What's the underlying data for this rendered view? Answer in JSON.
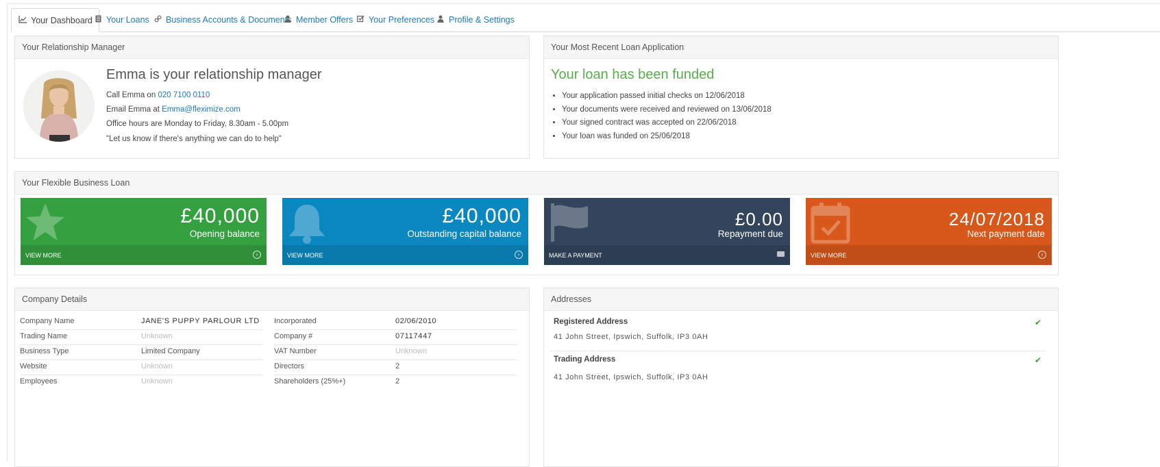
{
  "tabs": [
    {
      "label": "Your Dashboard",
      "icon": "line-chart-icon"
    },
    {
      "label": "Your Loans",
      "icon": "document-icon"
    },
    {
      "label": "Business Accounts & Documents",
      "icon": "link-icon"
    },
    {
      "label": "Member Offers",
      "icon": "user-icon"
    },
    {
      "label": "Your Preferences",
      "icon": "checkbox-icon"
    },
    {
      "label": "Profile & Settings",
      "icon": "user-icon"
    }
  ],
  "relationship_manager": {
    "heading": "Your Relationship Manager",
    "title": "Emma is your relationship manager",
    "call_prefix": "Call Emma on ",
    "phone": "020 7100 0110",
    "email_prefix": "Email Emma at ",
    "email": "Emma@fleximize.com",
    "hours": "Office hours are Monday to Friday, 8.30am - 5.00pm",
    "quote": "\"Let us know if there's anything we can do to help\""
  },
  "loan_application": {
    "heading": "Your Most Recent Loan Application",
    "status": "Your loan has been funded",
    "steps": [
      "Your application passed initial checks on 12/06/2018",
      "Your documents were received and reviewed on 13/06/2018",
      "Your signed contract was accepted on 22/06/2018",
      "Your loan was funded on 25/06/2018"
    ]
  },
  "flexible_loan": {
    "heading": "Your Flexible Business Loan",
    "tiles": [
      {
        "value": "£40,000",
        "label": "Opening balance",
        "footer": "VIEW MORE",
        "color": "#34a03f",
        "icon": "star-icon"
      },
      {
        "value": "£40,000",
        "label": "Outstanding capital balance",
        "footer": "VIEW MORE",
        "color": "#0b87bf",
        "icon": "bell-icon"
      },
      {
        "value": "£0.00",
        "label": "Repayment due",
        "footer": "MAKE A PAYMENT",
        "color": "#33455c",
        "icon": "flag-icon"
      },
      {
        "value": "24/07/2018",
        "label": "Next payment date",
        "footer": "VIEW MORE",
        "color": "#d8571a",
        "icon": "calendar-icon"
      }
    ]
  },
  "company_details": {
    "heading": "Company Details",
    "left": [
      {
        "label": "Company Name",
        "value": "JANE'S PUPPY PARLOUR LTD",
        "known": true
      },
      {
        "label": "Trading Name",
        "value": "Unknown",
        "known": false
      },
      {
        "label": "Business Type",
        "value": "Limited Company",
        "known": true
      },
      {
        "label": "Website",
        "value": "Unknown",
        "known": false
      },
      {
        "label": "Employees",
        "value": "Unknown",
        "known": false
      }
    ],
    "right": [
      {
        "label": "Incorporated",
        "value": "02/06/2010",
        "known": true
      },
      {
        "label": "Company #",
        "value": "07117447",
        "known": true
      },
      {
        "label": "VAT Number",
        "value": "Unknown",
        "known": false
      },
      {
        "label": "Directors",
        "value": "2",
        "known": true
      },
      {
        "label": "Shareholders (25%+)",
        "value": "2",
        "known": true
      }
    ]
  },
  "addresses": {
    "heading": "Addresses",
    "items": [
      {
        "title": "Registered Address",
        "address": "41 John Street, Ipswich, Suffolk, IP3 0AH"
      },
      {
        "title": "Trading Address",
        "address": "41 John Street, Ipswich, Suffolk, IP3 0AH"
      }
    ]
  }
}
